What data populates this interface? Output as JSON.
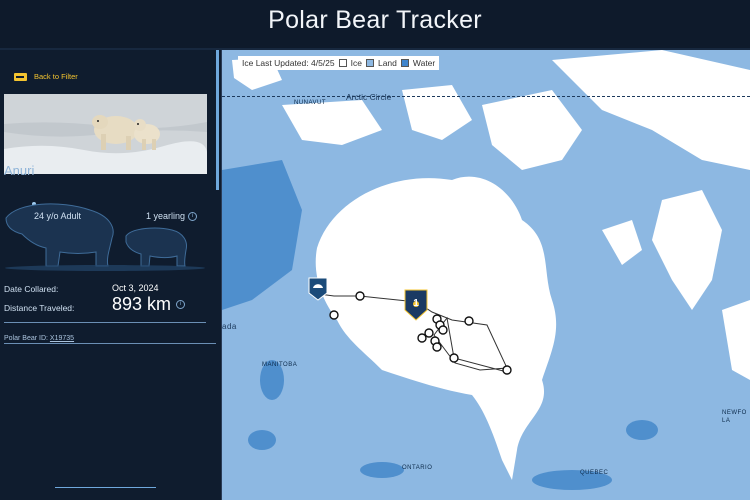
{
  "app": {
    "title": "Polar Bear Tracker"
  },
  "sidebar": {
    "back_label": "Back to Filter",
    "bear_name": "Anuri",
    "age_label": "24 y/o Adult",
    "yearling_label": "1 yearling",
    "date_collared_label": "Date Collared:",
    "date_collared_value": "Oct 3, 2024",
    "distance_label": "Distance Traveled:",
    "distance_value": "893 km",
    "bear_id_label": "Polar Bear ID:",
    "bear_id_value": "X19735"
  },
  "map": {
    "legend": {
      "updated": "Ice Last Updated: 4/5/25",
      "items": [
        {
          "label": "Ice",
          "color": "#ffffff"
        },
        {
          "label": "Land",
          "color": "#8db8e2"
        },
        {
          "label": "Water",
          "color": "#3f84cc"
        }
      ]
    },
    "arctic_circle_label": "Arctic Circle",
    "region_labels": {
      "nunavut": "NUNAVUT",
      "manitoba": "MANITOBA",
      "ontario": "ONTARIO",
      "quebec": "QUEBEC",
      "newfoundland_1": "NEWFO",
      "newfoundland_2": "LA",
      "canada_fragment": "ada"
    },
    "marker_number": "1",
    "colors": {
      "ice": "#ffffff",
      "land": "#8db8e2",
      "water": "#5b9bd5",
      "accent": "#f4c430"
    }
  }
}
